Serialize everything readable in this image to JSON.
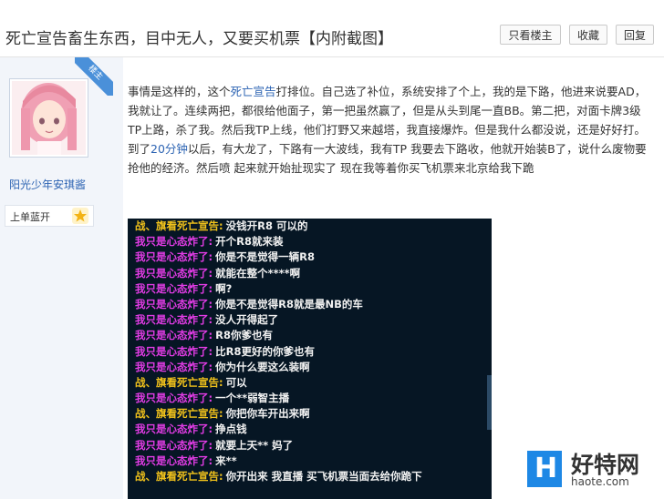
{
  "header": {
    "title": "死亡宣告畜生东西，目中无人，又要买机票【内附截图】",
    "buttons": [
      "只看楼主",
      "收藏",
      "回复"
    ]
  },
  "author": {
    "badge": "楼主",
    "username": "阳光少年安琪酱",
    "level": "上单蓝开",
    "level_icon": "star-icon"
  },
  "post": {
    "text_pre": "事情是这样的，这个",
    "link1": "死亡宣告",
    "text_mid1": "打排位。自己选了补位，系统安排了个上，我的是下路，他进来说要AD，我就让了。连续两把，都很给他面子，第一把虽然赢了，但是从头到尾一直BB。第二把，对面卡牌3级TP上路，杀了我。然后我TP上线，他们打野又来越塔，我直接爆炸。但是我什么都没说，还是好好打。到了",
    "link2": "20分钟",
    "text_post": "以后，有大龙了，下路有一大波线，我有TP 我要去下路收，他就开始装B了，说什么废物要抢他的经济。然后喷 起来就开始扯现实了 现在我等着你买飞机票来北京给我下跪"
  },
  "chat": [
    {
      "speaker": "战、旗看死亡宣告:",
      "speaker_color": "#f1c21b",
      "msg": "没钱开R8 可以的"
    },
    {
      "speaker": "我只是心态炸了:",
      "speaker_color": "#e33ce6",
      "msg": "开个R8就来装"
    },
    {
      "speaker": "我只是心态炸了:",
      "speaker_color": "#e33ce6",
      "msg": "你是不是觉得一辆R8"
    },
    {
      "speaker": "我只是心态炸了:",
      "speaker_color": "#e33ce6",
      "msg": "就能在整个****啊"
    },
    {
      "speaker": "我只是心态炸了:",
      "speaker_color": "#e33ce6",
      "msg": "啊?"
    },
    {
      "speaker": "我只是心态炸了:",
      "speaker_color": "#e33ce6",
      "msg": "你是不是觉得R8就是最NB的车"
    },
    {
      "speaker": "我只是心态炸了:",
      "speaker_color": "#e33ce6",
      "msg": "没人开得起了"
    },
    {
      "speaker": "我只是心态炸了:",
      "speaker_color": "#e33ce6",
      "msg": "R8你爹也有"
    },
    {
      "speaker": "我只是心态炸了:",
      "speaker_color": "#e33ce6",
      "msg": "比R8更好的你爹也有"
    },
    {
      "speaker": "我只是心态炸了:",
      "speaker_color": "#e33ce6",
      "msg": "你为什么要这么装啊"
    },
    {
      "speaker": "战、旗看死亡宣告:",
      "speaker_color": "#f1c21b",
      "msg": "可以"
    },
    {
      "speaker": "我只是心态炸了:",
      "speaker_color": "#e33ce6",
      "msg": "一个**弱智主播"
    },
    {
      "speaker": "战、旗看死亡宣告:",
      "speaker_color": "#f1c21b",
      "msg": "你把你车开出来啊"
    },
    {
      "speaker": "我只是心态炸了:",
      "speaker_color": "#e33ce6",
      "msg": "挣点钱"
    },
    {
      "speaker": "我只是心态炸了:",
      "speaker_color": "#e33ce6",
      "msg": "就要上天** 妈了"
    },
    {
      "speaker": "我只是心态炸了:",
      "speaker_color": "#e33ce6",
      "msg": "来**"
    },
    {
      "speaker": "战、旗看死亡宣告:",
      "speaker_color": "#f1c21b",
      "msg": "你开出来 我直播 买飞机票当面去给你跪下"
    }
  ],
  "watermark": {
    "logo_letter": "H",
    "name": "好特网",
    "url": "haote.com"
  }
}
